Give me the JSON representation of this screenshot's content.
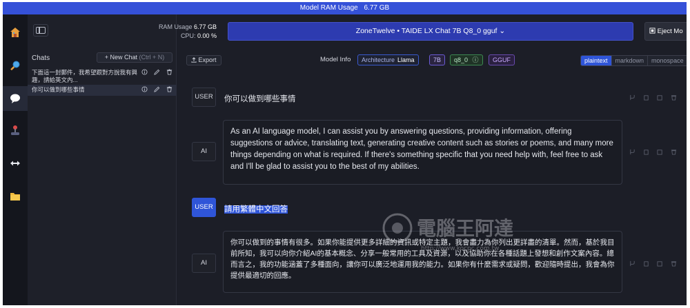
{
  "topbar": {
    "label": "Model RAM Usage",
    "value": "6.77 GB"
  },
  "header": {
    "ram_label": "RAM Usage",
    "ram_value": "6.77 GB",
    "cpu_label": "CPU:",
    "cpu_value": "0.00 %",
    "model_select": "ZoneTwelve • TAIDE LX Chat 7B Q8_0 gguf",
    "eject_label": "Eject Mo"
  },
  "sidebar": {
    "items": [
      {
        "icon": "home-icon",
        "active": false
      },
      {
        "icon": "search-icon",
        "active": false
      },
      {
        "icon": "chat-icon",
        "active": true
      },
      {
        "icon": "joystick-icon",
        "active": false
      },
      {
        "icon": "arrows-icon",
        "active": false
      },
      {
        "icon": "folder-icon",
        "active": false
      }
    ]
  },
  "chats": {
    "title": "Chats",
    "new_chat": "+ New Chat",
    "new_chat_shortcut": "(Ctrl + N)",
    "items": [
      {
        "title": "下面這一封郵件，我希望跟對方說我有興趣，請給英文內...",
        "active": false
      },
      {
        "title": "你可以做到哪些事情",
        "active": true
      }
    ]
  },
  "toolbar": {
    "export": "Export",
    "model_info": "Model Info",
    "architecture_label": "Architecture",
    "architecture_value": "Llama",
    "size": "7B",
    "quant": "q8_0",
    "format": "GGUF",
    "view_tabs": [
      "plaintext",
      "markdown",
      "monospace"
    ],
    "active_view": "plaintext"
  },
  "messages": [
    {
      "role": "USER",
      "text": "你可以做到哪些事情"
    },
    {
      "role": "AI",
      "text": "As an AI language model, I can assist you by answering questions, providing information, offering suggestions or advice, translating text, generating creative content such as stories or poems, and many more things depending on what is required. If there's something specific that you need help with, feel free to ask and I'll be glad to assist you to the best of my abilities."
    },
    {
      "role": "USER",
      "text": "請用繁體中文回答"
    },
    {
      "role": "AI",
      "text": "你可以做到的事情有很多。如果你能提供更多詳細的資訊或特定主題，我會盡力為你列出更詳盡的清單。然而，基於我目前所知，我可以向你介紹AI的基本概念、分享一般常用的工具及資源，以及協助你在各種話題上發想和創作文案內容。總而言之，我的功能涵蓋了多種面向，讓你可以廣泛地運用我的能力。如果你有什麼需求或疑問，歡迎隨時提出，我會為你提供最適切的回應。"
    }
  ],
  "watermark": {
    "text": "電腦王阿達",
    "url": "http://www.kocpc.com.tw"
  }
}
